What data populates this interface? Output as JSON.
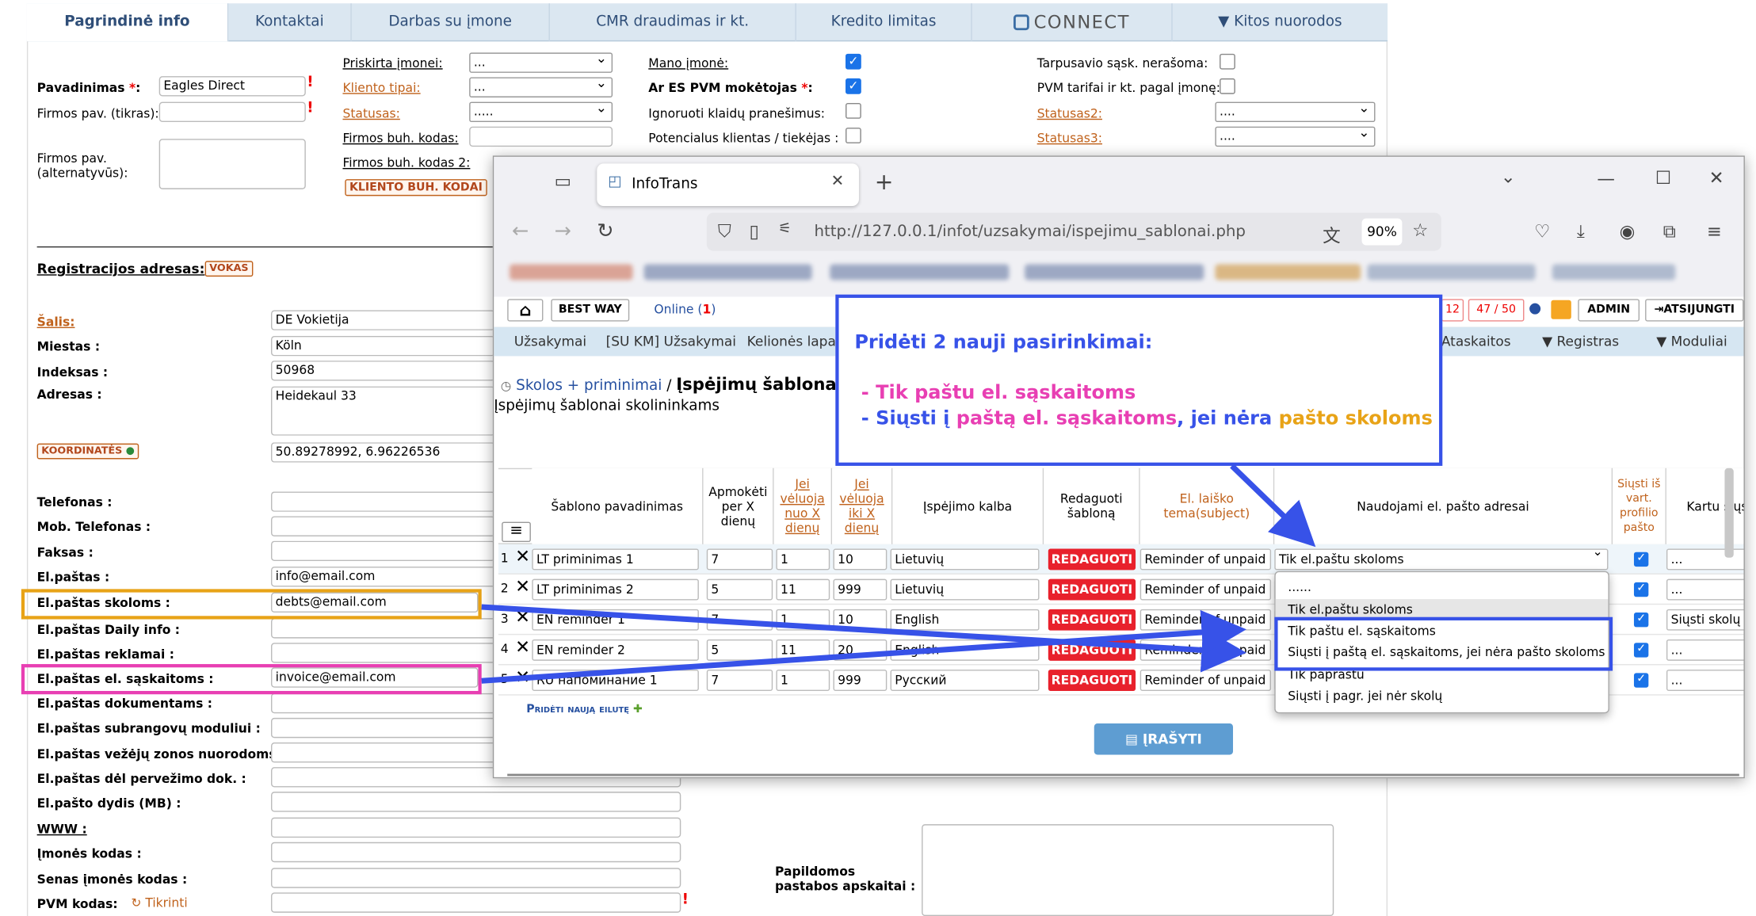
{
  "tabs": [
    {
      "label": "Pagrindinė info"
    },
    {
      "label": "Kontaktai"
    },
    {
      "label": "Darbas su įmone"
    },
    {
      "label": "CMR draudimas ir kt."
    },
    {
      "label": "Kredito limitas"
    },
    {
      "label": "CONNECT"
    },
    {
      "label": "▼ Kitos nuorodos"
    }
  ],
  "form": {
    "priskirta": "Priskirta įmonei:",
    "priskirta_val": "...",
    "kliento_tipai": "Kliento tipai:",
    "kliento_tipai_val": "...",
    "statusas": "Statusas:",
    "statusas_val": ".....",
    "firmos_buh": "Firmos buh. kodas:",
    "firmos_buh2": "Firmos buh. kodas 2:",
    "kliento_buh_btn": "KLIENTO BUH. KODAI",
    "pavadinimas": "Pavadinimas",
    "pavadinimas_val": "Eagles Direct",
    "firmos_tikras": "Firmos pav. (tikras):",
    "firmos_alt1": "Firmos pav.",
    "firmos_alt2": "(alternatyvūs):",
    "mano_imone": "Mano įmonė:",
    "es_pvm": "Ar ES PVM mokėtojas",
    "ignoruoti": "Ignoruoti klaidų pranešimus:",
    "potencialus": "Potencialus klientas / tiekėjas :",
    "tarpusavio": "Tarpusavio sąsk. nerašoma:",
    "pvm_tarifai": "PVM tarifai ir kt. pagal įmonę:",
    "statusas2": "Statusas2:",
    "statusas2_val": "....",
    "statusas3": "Statusas3:",
    "statusas3_val": "....",
    "reg_adresas": "Registracijos adresas:",
    "vokas": "VOKAS",
    "salis": "Šalis:",
    "salis_val": "DE Vokietija",
    "miestas": "Miestas :",
    "miestas_val": "Köln",
    "indeksas": "Indeksas :",
    "indeksas_val": "50968",
    "adresas": "Adresas :",
    "adresas_val": "Heidekaul 33",
    "koordinates": "KOORDINATĖS",
    "koordinates_val": "50.89278992, 6.96226536",
    "telefonas": "Telefonas :",
    "mob": "Mob. Telefonas :",
    "faksas": "Faksas :",
    "elpastas": "El.paštas :",
    "elpastas_val": "info@email.com",
    "el_skolos": "El.paštas skoloms :",
    "el_skolos_val": "debts@email.com",
    "el_daily": "El.paštas Daily info :",
    "el_reklamai": "El.paštas reklamai :",
    "el_saskaitoms": "El.paštas el. sąskaitoms :",
    "el_saskaitoms_val": "invoice@email.com",
    "el_dokumentams": "El.paštas dokumentams :",
    "el_subrangovu": "El.paštas subrangovų moduliui :",
    "el_vezeju": "El.paštas vežėjų zonos nuorodoms :",
    "el_perv": "El.paštas dėl pervežimo dok. :",
    "el_dydis": "El.pašto dydis (MB) :",
    "www": "WWW :",
    "imones_kodas": "Įmonės kodas :",
    "senas_kodas": "Senas įmonės kodas :",
    "pvm_kodas": "PVM kodas:",
    "tikrinti": "Tikrinti",
    "papildomos1": "Papildomos",
    "papildomos2": "pastabos apskaitai :"
  },
  "browser": {
    "tab_title": "InfoTrans",
    "url": "http://127.0.0.1/infot/uzsakymai/ispejimu_sablonai.php",
    "zoom": "90%"
  },
  "app": {
    "best_way": "BEST WAY",
    "online": "Online (",
    "online_count": "1",
    "online_close": ")",
    "counter1": "12",
    "counter2": "47 / 50",
    "admin": "ADMIN",
    "logout": "ATSIJUNGTI",
    "menu": [
      "Užsakymai",
      "[SU KM] Užsakymai",
      "Kelionės lapai"
    ],
    "menu_right": [
      "Ataskaitos",
      "▼ Registras",
      "▼ Moduliai"
    ],
    "breadcrumb_link": "Skolos + priminimai",
    "breadcrumb_sep": " / ",
    "breadcrumb_current": "Įspėjimų šablonai",
    "subtitle": "Įspėjimų šablonai skolininkams",
    "add_row": "Pridėti naują eilutę",
    "save": "ĮRAŠYTI"
  },
  "table": {
    "headers": [
      "Šablono pavadinimas",
      "Apmokėti per X dienų",
      "Jei vėluoja nuo X dienų",
      "Jei vėluoja iki X dienų",
      "Įspėjimo kalba",
      "Redaguoti šabloną",
      "El. laiško tema(subject)",
      "Naudojami el. pašto adresai",
      "Siųsti iš vart. profilio pašto",
      "Kartu siųsti failą"
    ],
    "rows": [
      {
        "num": "1",
        "name": "LT priminimas 1",
        "per": "7",
        "nuo": "1",
        "iki": "10",
        "lang": "Lietuvių",
        "subject": "Reminder of unpaid I",
        "emails": "Tik el.paštu skoloms",
        "file": "..."
      },
      {
        "num": "2",
        "name": "LT priminimas 2",
        "per": "5",
        "nuo": "11",
        "iki": "999",
        "lang": "Lietuvių",
        "subject": "Reminder of unpaid I",
        "emails": "",
        "file": "..."
      },
      {
        "num": "3",
        "name": "EN reminder 1",
        "per": "7",
        "nuo": "1",
        "iki": "10",
        "lang": "English",
        "subject": "Reminder of unpaid I",
        "emails": "",
        "file": "Siųsti skolų l"
      },
      {
        "num": "4",
        "name": "EN reminder 2",
        "per": "5",
        "nuo": "11",
        "iki": "20",
        "lang": "English",
        "subject": "Reminder of unpaid I",
        "emails": "",
        "file": "..."
      },
      {
        "num": "5",
        "name": "RU напоминание 1",
        "per": "7",
        "nuo": "1",
        "iki": "999",
        "lang": "Русский",
        "subject": "Reminder of unpaid I",
        "emails": "",
        "file": "..."
      }
    ],
    "edit_label": "REDAGUOTI"
  },
  "dropdown": {
    "options": [
      "......",
      "Tik el.paštu skoloms",
      "Tik paštu el. sąskaitoms",
      "Siųsti į paštą el. sąskaitoms, jei nėra pašto skoloms",
      "Tik paprastu",
      "Siųsti į pagr. jei nėr skolų"
    ]
  },
  "callout": {
    "title": "Pridėti 2 nauji pasirinkimai:",
    "line1": "- Tik paštu el. sąskaitoms",
    "line2a": "- Siųsti į ",
    "line2b": "paštą el. sąskaitoms",
    ", jei nėra ": "",
    "line2c": ", jei nėra ",
    "line2d": "pašto skoloms"
  },
  "colors": {
    "callout_border": "#3752e8",
    "highlight_yellow": "#e8a317",
    "highlight_pink": "#e83fb3",
    "edit_red": "#e8212c"
  }
}
